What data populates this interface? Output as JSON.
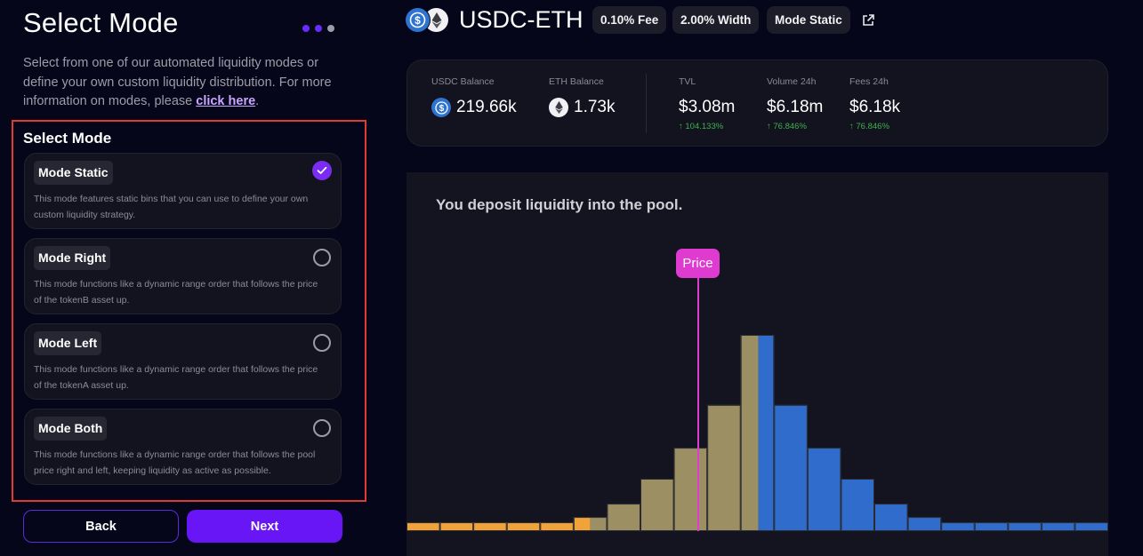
{
  "left_panel": {
    "title": "Select Mode",
    "steps": [
      {
        "state": "done"
      },
      {
        "state": "done"
      },
      {
        "state": "pending"
      }
    ],
    "intro_text": "Select from one of our automated liquidity modes or define your own custom liquidity distribution. For more information on modes, please ",
    "intro_link": "click here",
    "intro_end": ".",
    "section_title": "Select Mode",
    "modes": [
      {
        "label": "Mode Static",
        "description": "This mode features static bins that you can use to define your own custom liquidity strategy.",
        "selected": true
      },
      {
        "label": "Mode Right",
        "description": "This mode functions like a dynamic range order that follows the price of the tokenB asset up.",
        "selected": false
      },
      {
        "label": "Mode Left",
        "description": "This mode functions like a dynamic range order that follows the price of the tokenA asset up.",
        "selected": false
      },
      {
        "label": "Mode Both",
        "description": "This mode functions like a dynamic range order that follows the pool price right and left, keeping liquidity as active as possible.",
        "selected": false
      }
    ],
    "back_label": "Back",
    "next_label": "Next"
  },
  "header": {
    "pair": "USDC-ETH",
    "token_a_icon": "usdc-icon",
    "token_b_icon": "eth-icon",
    "chips": [
      "0.10% Fee",
      "2.00% Width",
      "Mode Static"
    ],
    "external_link_icon": "external-link-icon"
  },
  "stats": {
    "usdc_balance": {
      "label": "USDC Balance",
      "value": "219.66k"
    },
    "eth_balance": {
      "label": "ETH Balance",
      "value": "1.73k"
    },
    "tvl": {
      "label": "TVL",
      "value": "$3.08m",
      "change": "104.133%",
      "direction": "up"
    },
    "volume": {
      "label": "Volume 24h",
      "value": "$6.18m",
      "change": "76.846%",
      "direction": "up"
    },
    "fees": {
      "label": "Fees 24h",
      "value": "$6.18k",
      "change": "76.846%",
      "direction": "up"
    }
  },
  "theme": {
    "accent": "#6816f6",
    "highlight_frame": "#e03a36",
    "positive": "#3db24a",
    "price_marker": "#e03bd0"
  },
  "chart_data": {
    "type": "bar",
    "title": "You deposit liquidity into the pool.",
    "xlabel": "",
    "ylabel": "",
    "ylim": [
      0,
      100
    ],
    "grid": false,
    "legend": "none",
    "colors": {
      "tokenA": "#f0a33b",
      "deposit": "#9c8f63",
      "tokenB": "#2f6ccc"
    },
    "price_marker": {
      "label": "Price",
      "bin_position": 8.73
    },
    "bins": [
      {
        "value": 4.5,
        "segments": [
          {
            "token": "tokenA",
            "fraction": 1
          }
        ]
      },
      {
        "value": 4.5,
        "segments": [
          {
            "token": "tokenA",
            "fraction": 1
          }
        ]
      },
      {
        "value": 4.5,
        "segments": [
          {
            "token": "tokenA",
            "fraction": 1
          }
        ]
      },
      {
        "value": 4.5,
        "segments": [
          {
            "token": "tokenA",
            "fraction": 1
          }
        ]
      },
      {
        "value": 4.5,
        "segments": [
          {
            "token": "tokenA",
            "fraction": 1
          }
        ]
      },
      {
        "value": 7.2,
        "segments": [
          {
            "token": "tokenA",
            "fraction": 0.5
          },
          {
            "token": "deposit",
            "fraction": 0.5
          }
        ]
      },
      {
        "value": 14.0,
        "segments": [
          {
            "token": "deposit",
            "fraction": 1
          }
        ]
      },
      {
        "value": 26.7,
        "segments": [
          {
            "token": "deposit",
            "fraction": 1
          }
        ]
      },
      {
        "value": 42.5,
        "segments": [
          {
            "token": "deposit",
            "fraction": 1
          }
        ]
      },
      {
        "value": 64.3,
        "segments": [
          {
            "token": "deposit",
            "fraction": 1
          }
        ]
      },
      {
        "value": 100,
        "segments": [
          {
            "token": "deposit",
            "fraction": 0.53
          },
          {
            "token": "tokenB",
            "fraction": 0.47
          }
        ]
      },
      {
        "value": 64.3,
        "segments": [
          {
            "token": "tokenB",
            "fraction": 1
          }
        ]
      },
      {
        "value": 42.5,
        "segments": [
          {
            "token": "tokenB",
            "fraction": 1
          }
        ]
      },
      {
        "value": 26.7,
        "segments": [
          {
            "token": "tokenB",
            "fraction": 1
          }
        ]
      },
      {
        "value": 14.0,
        "segments": [
          {
            "token": "tokenB",
            "fraction": 1
          }
        ]
      },
      {
        "value": 7.2,
        "segments": [
          {
            "token": "tokenB",
            "fraction": 1
          }
        ]
      },
      {
        "value": 4.5,
        "segments": [
          {
            "token": "tokenB",
            "fraction": 1
          }
        ]
      },
      {
        "value": 4.5,
        "segments": [
          {
            "token": "tokenB",
            "fraction": 1
          }
        ]
      },
      {
        "value": 4.5,
        "segments": [
          {
            "token": "tokenB",
            "fraction": 1
          }
        ]
      },
      {
        "value": 4.5,
        "segments": [
          {
            "token": "tokenB",
            "fraction": 1
          }
        ]
      },
      {
        "value": 4.5,
        "segments": [
          {
            "token": "tokenB",
            "fraction": 1
          }
        ]
      }
    ]
  }
}
